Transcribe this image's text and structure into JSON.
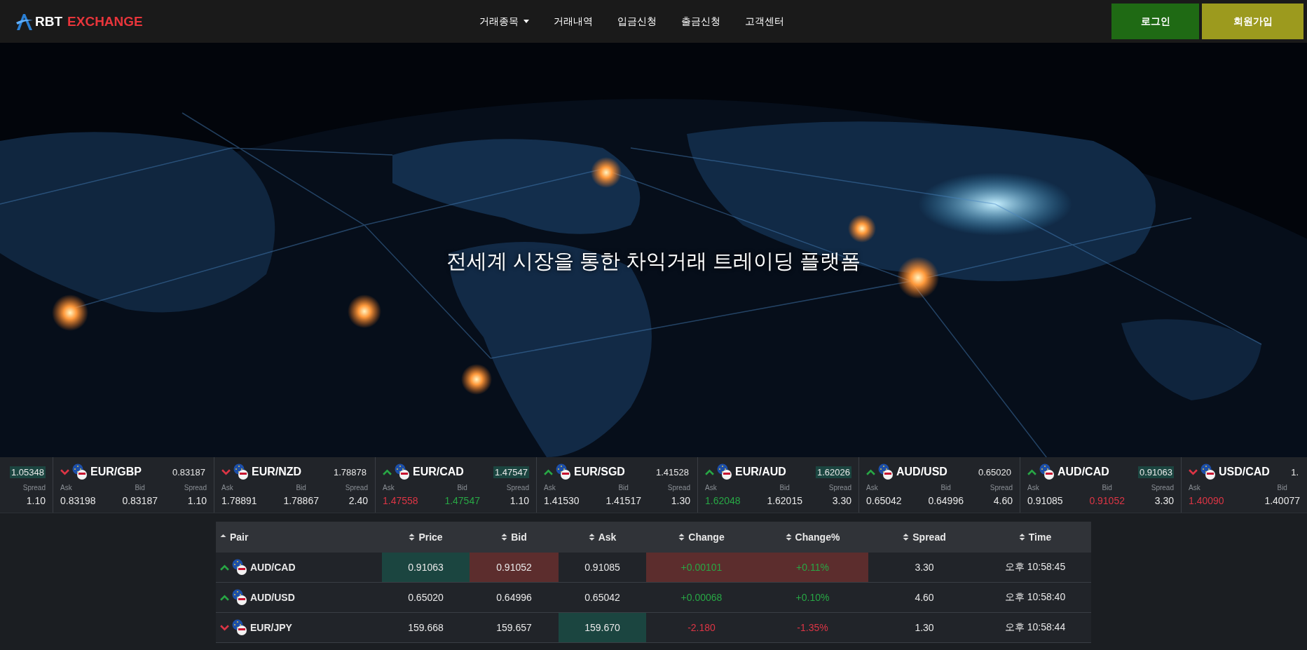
{
  "header": {
    "logo_main": "RBT",
    "logo_accent": "EXCHANGE",
    "nav": [
      {
        "label": "거래종목",
        "dropdown": true
      },
      {
        "label": "거래내역",
        "dropdown": false
      },
      {
        "label": "입금신청",
        "dropdown": false
      },
      {
        "label": "출금신청",
        "dropdown": false
      },
      {
        "label": "고객센터",
        "dropdown": false
      }
    ],
    "buttons": [
      {
        "label": "로그인",
        "kind": "login"
      },
      {
        "label": "회원가입",
        "kind": "signup"
      }
    ]
  },
  "hero": {
    "title": "전세계 시장을 통한 차익거래 트레이딩 플랫폼"
  },
  "ticker": [
    {
      "kind": "partial-start",
      "price": "1.05348",
      "price_highlighted": true,
      "spread_label": "Spread",
      "spread": "1.10"
    },
    {
      "kind": "full",
      "rising": false,
      "pair": "EUR/GBP",
      "price": "0.83187",
      "price_highlighted": false,
      "ask_label": "Ask",
      "ask": "0.83198",
      "ask_rising": false,
      "ask_falling": false,
      "bid_label": "Bid",
      "bid": "0.83187",
      "bid_rising": false,
      "bid_falling": false,
      "spread_label": "Spread",
      "spread": "1.10"
    },
    {
      "kind": "full",
      "rising": false,
      "pair": "EUR/NZD",
      "price": "1.78878",
      "price_highlighted": false,
      "ask_label": "Ask",
      "ask": "1.78891",
      "ask_rising": false,
      "ask_falling": false,
      "bid_label": "Bid",
      "bid": "1.78867",
      "bid_rising": false,
      "bid_falling": false,
      "spread_label": "Spread",
      "spread": "2.40"
    },
    {
      "kind": "full",
      "rising": true,
      "pair": "EUR/CAD",
      "price": "1.47547",
      "price_highlighted": true,
      "ask_label": "Ask",
      "ask": "1.47558",
      "ask_rising": false,
      "ask_falling": true,
      "bid_label": "Bid",
      "bid": "1.47547",
      "bid_rising": true,
      "bid_falling": false,
      "spread_label": "Spread",
      "spread": "1.10"
    },
    {
      "kind": "full",
      "rising": true,
      "pair": "EUR/SGD",
      "price": "1.41528",
      "price_highlighted": false,
      "ask_label": "Ask",
      "ask": "1.41530",
      "ask_rising": false,
      "ask_falling": false,
      "bid_label": "Bid",
      "bid": "1.41517",
      "bid_rising": false,
      "bid_falling": false,
      "spread_label": "Spread",
      "spread": "1.30"
    },
    {
      "kind": "full",
      "rising": true,
      "pair": "EUR/AUD",
      "price": "1.62026",
      "price_highlighted": true,
      "ask_label": "Ask",
      "ask": "1.62048",
      "ask_rising": true,
      "ask_falling": false,
      "bid_label": "Bid",
      "bid": "1.62015",
      "bid_rising": false,
      "bid_falling": false,
      "spread_label": "Spread",
      "spread": "3.30"
    },
    {
      "kind": "full",
      "rising": true,
      "pair": "AUD/USD",
      "price": "0.65020",
      "price_highlighted": false,
      "ask_label": "Ask",
      "ask": "0.65042",
      "ask_rising": false,
      "ask_falling": false,
      "bid_label": "Bid",
      "bid": "0.64996",
      "bid_rising": false,
      "bid_falling": false,
      "spread_label": "Spread",
      "spread": "4.60"
    },
    {
      "kind": "full",
      "rising": true,
      "pair": "AUD/CAD",
      "price": "0.91063",
      "price_highlighted": true,
      "ask_label": "Ask",
      "ask": "0.91085",
      "ask_rising": false,
      "ask_falling": false,
      "bid_label": "Bid",
      "bid": "0.91052",
      "bid_rising": false,
      "bid_falling": true,
      "spread_label": "Spread",
      "spread": "3.30"
    },
    {
      "kind": "partial-end",
      "rising": false,
      "pair": "USD/CAD",
      "price": "1.",
      "price_highlighted": false,
      "ask_label": "Ask",
      "ask": "1.40090",
      "ask_rising": false,
      "ask_falling": true,
      "bid_label": "Bid",
      "bid": "1.40077",
      "bid_rising": false,
      "bid_falling": false
    }
  ],
  "table": {
    "columns": [
      {
        "label": "Pair",
        "sorted": true
      },
      {
        "label": "Price",
        "sorted": false
      },
      {
        "label": "Bid",
        "sorted": false
      },
      {
        "label": "Ask",
        "sorted": false
      },
      {
        "label": "Change",
        "sorted": false
      },
      {
        "label": "Change%",
        "sorted": false
      },
      {
        "label": "Spread",
        "sorted": false
      },
      {
        "label": "Time",
        "sorted": false
      }
    ],
    "rows": [
      {
        "rising": true,
        "cells": [
          {
            "text": "AUD/CAD"
          },
          {
            "text": "0.91063",
            "flash_up": true,
            "flash_down": false
          },
          {
            "text": "0.91052",
            "flash_up": false,
            "flash_down": true
          },
          {
            "text": "0.91085",
            "flash_up": false,
            "flash_down": false
          },
          {
            "text": "+0.00101",
            "flash_up": false,
            "flash_down": true,
            "positive": true
          },
          {
            "text": "+0.11%",
            "flash_up": false,
            "flash_down": true,
            "positive": true
          },
          {
            "text": "3.30",
            "flash_up": false,
            "flash_down": false
          },
          {
            "text": "오후 10:58:45",
            "flash_up": false,
            "flash_down": false
          }
        ]
      },
      {
        "rising": true,
        "cells": [
          {
            "text": "AUD/USD"
          },
          {
            "text": "0.65020",
            "flash_up": false,
            "flash_down": false
          },
          {
            "text": "0.64996",
            "flash_up": false,
            "flash_down": false
          },
          {
            "text": "0.65042",
            "flash_up": false,
            "flash_down": false
          },
          {
            "text": "+0.00068",
            "flash_up": false,
            "flash_down": false,
            "positive": true
          },
          {
            "text": "+0.10%",
            "flash_up": false,
            "flash_down": false,
            "positive": true
          },
          {
            "text": "4.60",
            "flash_up": false,
            "flash_down": false
          },
          {
            "text": "오후 10:58:40",
            "flash_up": false,
            "flash_down": false
          }
        ]
      },
      {
        "rising": false,
        "cells": [
          {
            "text": "EUR/JPY"
          },
          {
            "text": "159.668",
            "flash_up": false,
            "flash_down": false
          },
          {
            "text": "159.657",
            "flash_up": false,
            "flash_down": false
          },
          {
            "text": "159.670",
            "flash_up": true,
            "flash_down": false
          },
          {
            "text": "-2.180",
            "flash_up": false,
            "flash_down": false,
            "positive": false
          },
          {
            "text": "-1.35%",
            "flash_up": false,
            "flash_down": false,
            "positive": false
          },
          {
            "text": "1.30",
            "flash_up": false,
            "flash_down": false
          },
          {
            "text": "오후 10:58:44",
            "flash_up": false,
            "flash_down": false
          }
        ]
      }
    ]
  }
}
